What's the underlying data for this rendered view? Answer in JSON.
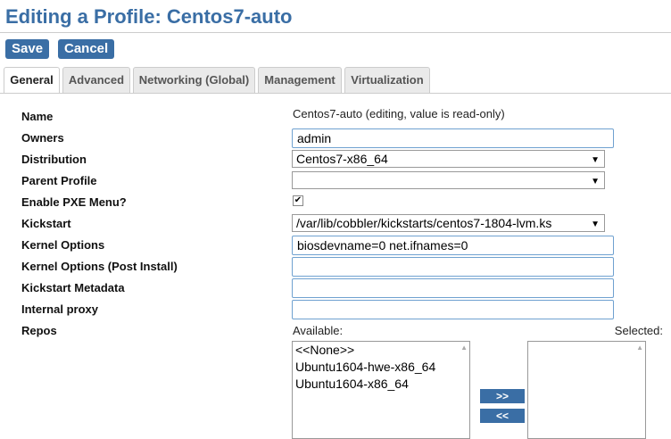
{
  "page": {
    "title": "Editing a Profile: Centos7-auto"
  },
  "actions": {
    "save_label": "Save",
    "cancel_label": "Cancel"
  },
  "tabs": [
    {
      "label": "General"
    },
    {
      "label": "Advanced"
    },
    {
      "label": "Networking (Global)"
    },
    {
      "label": "Management"
    },
    {
      "label": "Virtualization"
    }
  ],
  "form": {
    "name": {
      "label": "Name",
      "value": "Centos7-auto (editing, value is read-only)"
    },
    "owners": {
      "label": "Owners",
      "value": "admin"
    },
    "distribution": {
      "label": "Distribution",
      "value": "Centos7-x86_64"
    },
    "parent_profile": {
      "label": "Parent Profile",
      "value": ""
    },
    "enable_pxe": {
      "label": "Enable PXE Menu?",
      "checked": true,
      "mark": "✔"
    },
    "kickstart": {
      "label": "Kickstart",
      "value": "/var/lib/cobbler/kickstarts/centos7-1804-lvm.ks"
    },
    "kernel_options": {
      "label": "Kernel Options",
      "value": "biosdevname=0 net.ifnames=0"
    },
    "kernel_options_post": {
      "label": "Kernel Options (Post Install)",
      "value": ""
    },
    "kickstart_metadata": {
      "label": "Kickstart Metadata",
      "value": ""
    },
    "internal_proxy": {
      "label": "Internal proxy",
      "value": ""
    },
    "repos": {
      "label": "Repos",
      "available_label": "Available:",
      "selected_label": "Selected:",
      "available": [
        "<<None>>",
        "Ubuntu1604-hwe-x86_64",
        "Ubuntu1604-x86_64"
      ],
      "selected": [],
      "add_label": ">>",
      "remove_label": "<<"
    }
  },
  "colors": {
    "accent": "#3a6ea5",
    "input_border": "#6fa1d0"
  },
  "icons": {
    "dropdown": "▼",
    "scroll_up": "▲"
  }
}
